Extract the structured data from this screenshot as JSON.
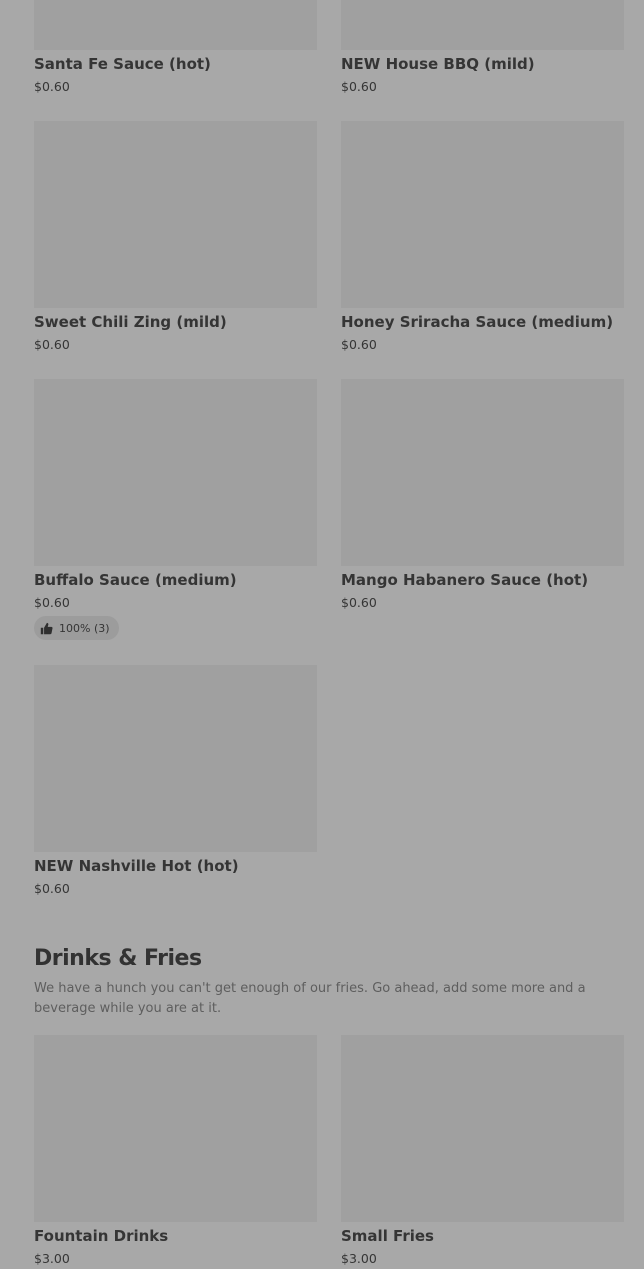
{
  "sauces": [
    {
      "name": "Santa Fe Sauce (hot)",
      "price": "$0.60"
    },
    {
      "name": "NEW House BBQ (mild)",
      "price": "$0.60"
    },
    {
      "name": "Sweet Chili Zing (mild)",
      "price": "$0.60"
    },
    {
      "name": "Honey Sriracha Sauce (medium)",
      "price": "$0.60"
    },
    {
      "name": "Buffalo Sauce (medium)",
      "price": "$0.60",
      "rating": "100% (3)",
      "rating_icon": "thumbs-up-icon"
    },
    {
      "name": "Mango Habanero Sauce (hot)",
      "price": "$0.60"
    },
    {
      "name": "NEW Nashville Hot (hot)",
      "price": "$0.60"
    }
  ],
  "drinks_fries": {
    "title": "Drinks & Fries",
    "description": "We have a hunch you can't get enough of our fries. Go ahead, add some more and a beverage while you are at it.",
    "items": [
      {
        "name": "Fountain Drinks",
        "price": "$3.00"
      },
      {
        "name": "Small Fries",
        "price": "$3.00"
      }
    ]
  }
}
